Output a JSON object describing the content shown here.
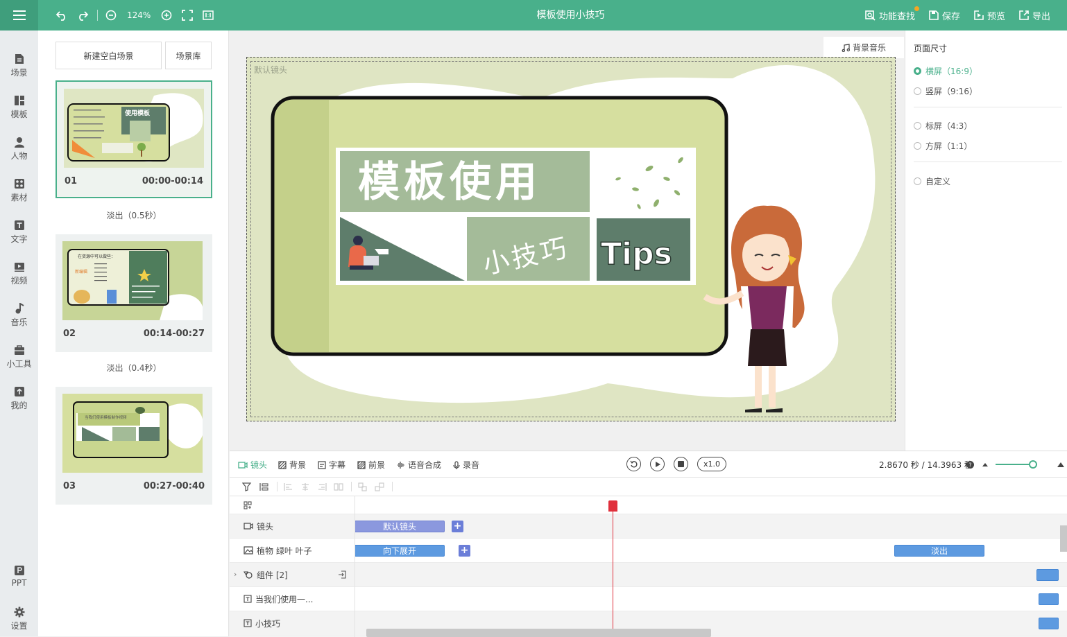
{
  "app": {
    "title": "模板使用小技巧",
    "zoom": "124%",
    "accent_color": "#49b08b"
  },
  "toolbar": {
    "left_icons": [
      "menu-icon",
      "undo-icon",
      "redo-icon",
      "zoom-out-icon",
      "zoom-in-icon",
      "fullscreen-icon",
      "actual-size-icon"
    ],
    "actions": [
      {
        "label": "功能查找",
        "icon": "search-icon"
      },
      {
        "label": "保存",
        "icon": "save-icon"
      },
      {
        "label": "预览",
        "icon": "preview-icon"
      },
      {
        "label": "导出",
        "icon": "export-icon"
      }
    ]
  },
  "nav": [
    {
      "label": "场景",
      "icon": "scene-icon"
    },
    {
      "label": "模板",
      "icon": "template-icon"
    },
    {
      "label": "人物",
      "icon": "person-icon"
    },
    {
      "label": "素材",
      "icon": "material-icon"
    },
    {
      "label": "文字",
      "icon": "text-icon"
    },
    {
      "label": "视频",
      "icon": "video-icon"
    },
    {
      "label": "音乐",
      "icon": "music-icon"
    },
    {
      "label": "小工具",
      "icon": "toolbox-icon"
    },
    {
      "label": "我的",
      "icon": "upload-icon"
    },
    {
      "label": "PPT",
      "icon": "ppt-icon"
    },
    {
      "label": "设置",
      "icon": "gear-icon"
    }
  ],
  "scenes": {
    "new_button": "新建空白场景",
    "library_button": "场景库",
    "items": [
      {
        "num": "01",
        "time": "00:00-00:14",
        "transition": "淡出（0.5秒）",
        "selected": true
      },
      {
        "num": "02",
        "time": "00:14-00:27",
        "transition": "淡出（0.4秒）",
        "selected": false
      },
      {
        "num": "03",
        "time": "00:27-00:40",
        "transition": "",
        "selected": false
      }
    ]
  },
  "canvas": {
    "bgm_button": "背景音乐",
    "lens_label": "默认镜头",
    "heading": "模板使用",
    "subheading": "小技巧",
    "tips": "Tips"
  },
  "page_size": {
    "title": "页面尺寸",
    "options": [
      {
        "label": "横屏（16:9）",
        "selected": true
      },
      {
        "label": "竖屏（9:16）",
        "selected": false
      },
      {
        "label": "标屏（4:3）",
        "selected": false
      },
      {
        "label": "方屏（1:1）",
        "selected": false
      },
      {
        "label": "自定义",
        "selected": false
      }
    ]
  },
  "timeline": {
    "tabs": [
      "镜头",
      "背景",
      "字幕",
      "前景",
      "语音合成",
      "录音"
    ],
    "speed": "x1.0",
    "time_display": "2.8670 秒 / 14.3963 秒",
    "tracks": [
      {
        "label": "镜头",
        "icon": "camera-icon",
        "clips": [
          "默认镜头"
        ]
      },
      {
        "label": "植物 绿叶 叶子",
        "icon": "image-icon",
        "clips": [
          "向下展开",
          "淡出"
        ]
      },
      {
        "label": "组件 [2]",
        "icon": "group-icon",
        "clips": []
      },
      {
        "label": "当我们使用一...",
        "icon": "text-icon",
        "clips": []
      },
      {
        "label": "小技巧",
        "icon": "text-icon",
        "clips": []
      }
    ]
  }
}
